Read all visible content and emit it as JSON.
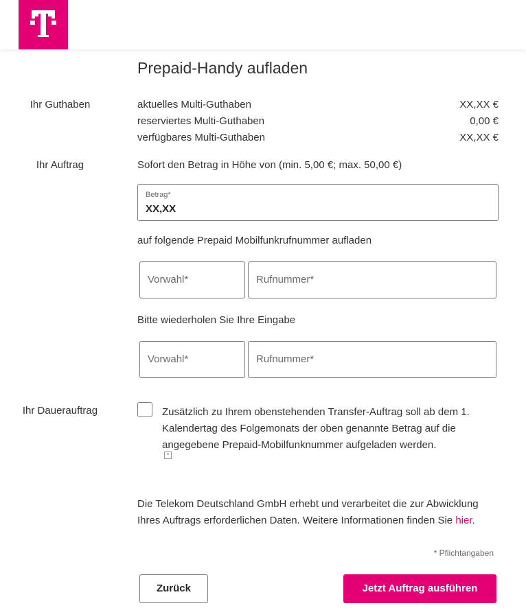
{
  "header": {
    "logo": "telekom-t-logo"
  },
  "page": {
    "title": "Prepaid-Handy aufladen"
  },
  "balance": {
    "section_label": "Ihr Guthaben",
    "rows": [
      {
        "label": "aktuelles Multi-Guthaben",
        "value": "XX,XX €"
      },
      {
        "label": "reserviertes Multi-Guthaben",
        "value": "0,00 €"
      },
      {
        "label": "verfügbares Multi-Guthaben",
        "value": "XX,XX €"
      }
    ]
  },
  "order": {
    "section_label": "Ihr Auftrag",
    "intro": "Sofort den Betrag in Höhe von (min. 5,00 €; max. 50,00 €)",
    "amount_label": "Betrag*",
    "amount_value": "XX,XX",
    "number_intro": "auf folgende Prepaid Mobilfunkrufnummer aufladen",
    "prefix_placeholder": "Vorwahl*",
    "number_placeholder": "Rufnummer*",
    "repeat_intro": "Bitte wiederholen Sie Ihre Eingabe",
    "repeat_prefix_placeholder": "Vorwahl*",
    "repeat_number_placeholder": "Rufnummer*"
  },
  "standing_order": {
    "section_label": "Ihr Dauerauftrag",
    "checkbox_text": "Zusätzlich zu Ihrem obenstehenden Transfer-Auftrag soll ab dem 1. Kalendertag des Folgemonats der oben genannte Betrag auf die angegebene Prepaid-Mobilfunknummer aufgeladen werden.",
    "checked": false
  },
  "privacy": {
    "text": "Die Telekom Deutschland GmbH erhebt und verarbeitet die zur Abwicklung Ihres Auftrags erforderlichen Daten. Weitere Informationen finden Sie ",
    "link_text": "hier",
    "suffix": "."
  },
  "required_note": "* Pflichtangaben",
  "buttons": {
    "back": "Zurück",
    "submit": "Jetzt Auftrag ausführen"
  },
  "colors": {
    "brand": "#e20074"
  }
}
